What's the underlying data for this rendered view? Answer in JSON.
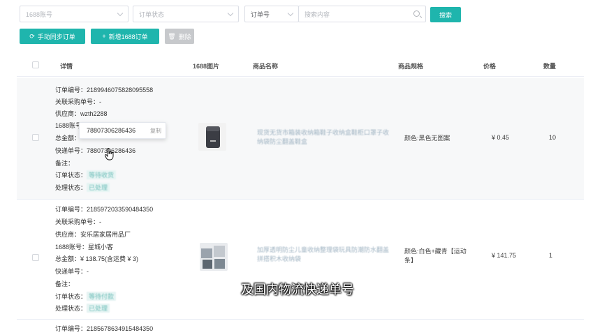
{
  "filters": {
    "account_placeholder": "1688账号",
    "status_placeholder": "订单状态",
    "order_no_select": "订单号",
    "search_placeholder": "搜索内容",
    "search_button": "搜索"
  },
  "actions": {
    "sync_label": "手动同步订单",
    "add_label": "新增1688订单",
    "delete_label": "删除"
  },
  "columns": {
    "details": "详情",
    "image": "1688图片",
    "name": "商品名称",
    "spec": "商品规格",
    "price": "价格",
    "qty": "数量"
  },
  "labels": {
    "order_no": "订单编号：",
    "purchase_no": "关联采购单号：",
    "supplier": "供应商：",
    "account": "1688账号：",
    "amount": "总金额：",
    "tracking": "快递单号：",
    "note": "备注：",
    "order_status": "订单状态：",
    "process_status": "处理状态："
  },
  "orders": [
    {
      "order_no": "2189946075828095558",
      "purchase_no": "-",
      "supplier": "wzth2288",
      "tracking": "78807306286436",
      "order_status": "等待收货",
      "process_status": "已处理",
      "product_name": "现货无货市箱装收纳箱鞋子收纳盒鞋柜口罩子收纳袋防尘翻盖鞋盒",
      "spec": "颜色:黑色无图案",
      "price": "¥ 0.45",
      "qty": "10"
    },
    {
      "order_no": "2185972033590484350",
      "purchase_no": "-",
      "supplier": "安乐居家居用品厂",
      "account": "星城小客",
      "amount": "¥ 138.75(含运费 ¥ 3)",
      "tracking": "-",
      "order_status": "等待付款",
      "process_status": "已处理",
      "product_name": "加厚透明防尘儿童收纳整理袋玩具防潮防水翻盖拼搭积木收纳袋",
      "spec": "颜色:白色+藏青【运动条】",
      "price": "¥ 141.75",
      "qty": "1"
    },
    {
      "order_no": "2185678634915484350"
    }
  ],
  "tooltip": {
    "value": "78807306286436",
    "copy": "复制"
  },
  "caption": "及国内物流快递单号",
  "colors": {
    "accent": "#1fb5ad",
    "disabled": "#c7c9cc",
    "row_hover": "#f7f8f9"
  }
}
